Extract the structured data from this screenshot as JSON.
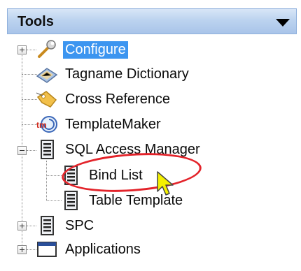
{
  "panel": {
    "title": "Tools"
  },
  "tree": {
    "items": [
      {
        "label": "Configure",
        "icon": "wrench-icon",
        "selected": true
      },
      {
        "label": "Tagname Dictionary",
        "icon": "dictionary-book-icon"
      },
      {
        "label": "Cross Reference",
        "icon": "tag-icon"
      },
      {
        "label": "TemplateMaker",
        "icon": "template-maker-icon"
      },
      {
        "label": "SQL Access Manager",
        "icon": "document-list-icon"
      },
      {
        "label": "Bind List",
        "icon": "document-list-icon"
      },
      {
        "label": "Table Template",
        "icon": "document-list-icon"
      },
      {
        "label": "SPC",
        "icon": "document-list-icon"
      },
      {
        "label": "Applications",
        "icon": "window-icon"
      }
    ]
  },
  "colors": {
    "selection": "#3c95f0",
    "highlight_circle": "#e3232a",
    "cursor": "#f4f000"
  }
}
